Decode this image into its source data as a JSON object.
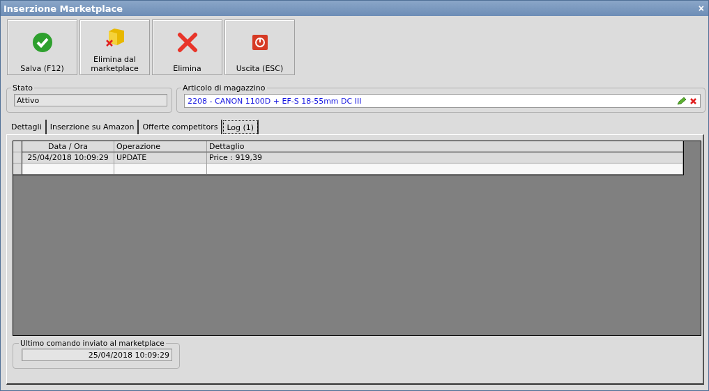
{
  "window": {
    "title": "Inserzione Marketplace",
    "close": "×"
  },
  "toolbar": [
    {
      "label": "Salva (F12)",
      "kind": "save"
    },
    {
      "label": "Elimina dal\nmarketplace",
      "kind": "box-delete"
    },
    {
      "label": "Elimina",
      "kind": "delete"
    },
    {
      "label": "Uscita (ESC)",
      "kind": "exit"
    }
  ],
  "stato": {
    "label": "Stato",
    "value": "Attivo"
  },
  "articolo": {
    "label": "Articolo di magazzino",
    "value": "2208 - CANON 1100D + EF-S 18-55mm DC III"
  },
  "tabs": [
    {
      "label": "Dettagli",
      "selected": false
    },
    {
      "label": "Inserzione su Amazon",
      "selected": false
    },
    {
      "label": "Offerte competitors",
      "selected": false
    },
    {
      "label": "Log (1)",
      "selected": true
    }
  ],
  "table": {
    "columns": [
      "Data / Ora",
      "Operazione",
      "Dettaglio"
    ],
    "rows": [
      [
        "25/04/2018 10:09:29",
        "UPDATE",
        "Price : 919,39"
      ]
    ]
  },
  "ultimo": {
    "label": "Ultimo comando inviato al marketplace",
    "value": "25/04/2018 10:09:29"
  }
}
